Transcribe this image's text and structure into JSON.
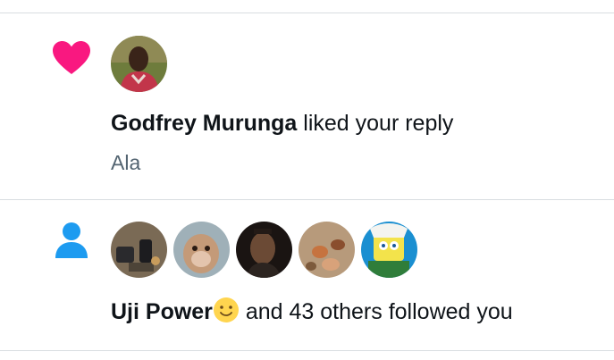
{
  "notifications": [
    {
      "type": "like",
      "icon": "heart-icon",
      "icon_color": "#f91880",
      "actor": "Godfrey Murunga",
      "action": " liked your reply",
      "quote": "Ala"
    },
    {
      "type": "follow",
      "icon": "person-icon",
      "icon_color": "#1d9bf0",
      "actor": "Uji Power",
      "actor_emoji": "slightly-smiling-face-emoji",
      "action": " and 43 others followed you",
      "avatar_count": 5
    }
  ],
  "colors": {
    "divider": "#d9dde1",
    "secondary_text": "#536471",
    "primary_text": "#0f1419"
  }
}
